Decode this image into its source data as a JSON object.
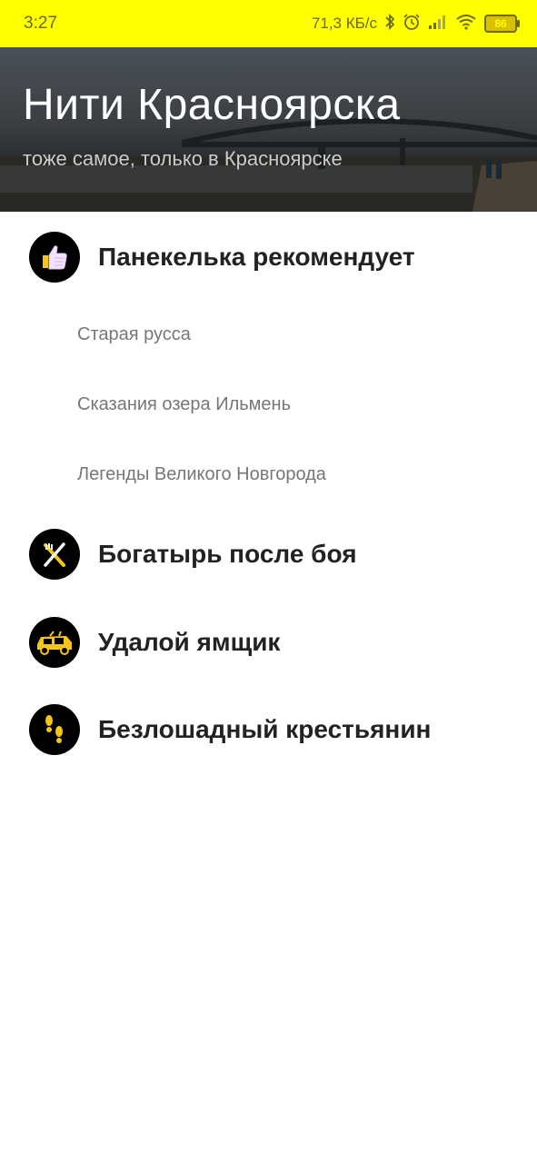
{
  "status_bar": {
    "time": "3:27",
    "speed": "71,3 КБ/с",
    "battery": "86",
    "icons": [
      "bluetooth-icon",
      "alarm-icon",
      "signal-icon",
      "wifi-icon",
      "battery-icon"
    ]
  },
  "header": {
    "title": "Нити Красноярска",
    "subtitle": "тоже самое, только в Красноярске"
  },
  "menu": {
    "categories": [
      {
        "label": "Панекелька рекомендует",
        "icon": "thumbs-up-icon",
        "items": [
          "Старая русса",
          "Сказания озера Ильмень",
          "Легенды Великого Новгорода"
        ]
      },
      {
        "label": "Богатырь после боя",
        "icon": "fork-knife-icon"
      },
      {
        "label": "Удалой ямщик",
        "icon": "car-icon"
      },
      {
        "label": "Безлошадный крестьянин",
        "icon": "footprints-icon"
      }
    ]
  },
  "colors": {
    "status_bar": "#ffff00",
    "accent_yellow": "#f5c518",
    "icon_bg": "#000000"
  }
}
